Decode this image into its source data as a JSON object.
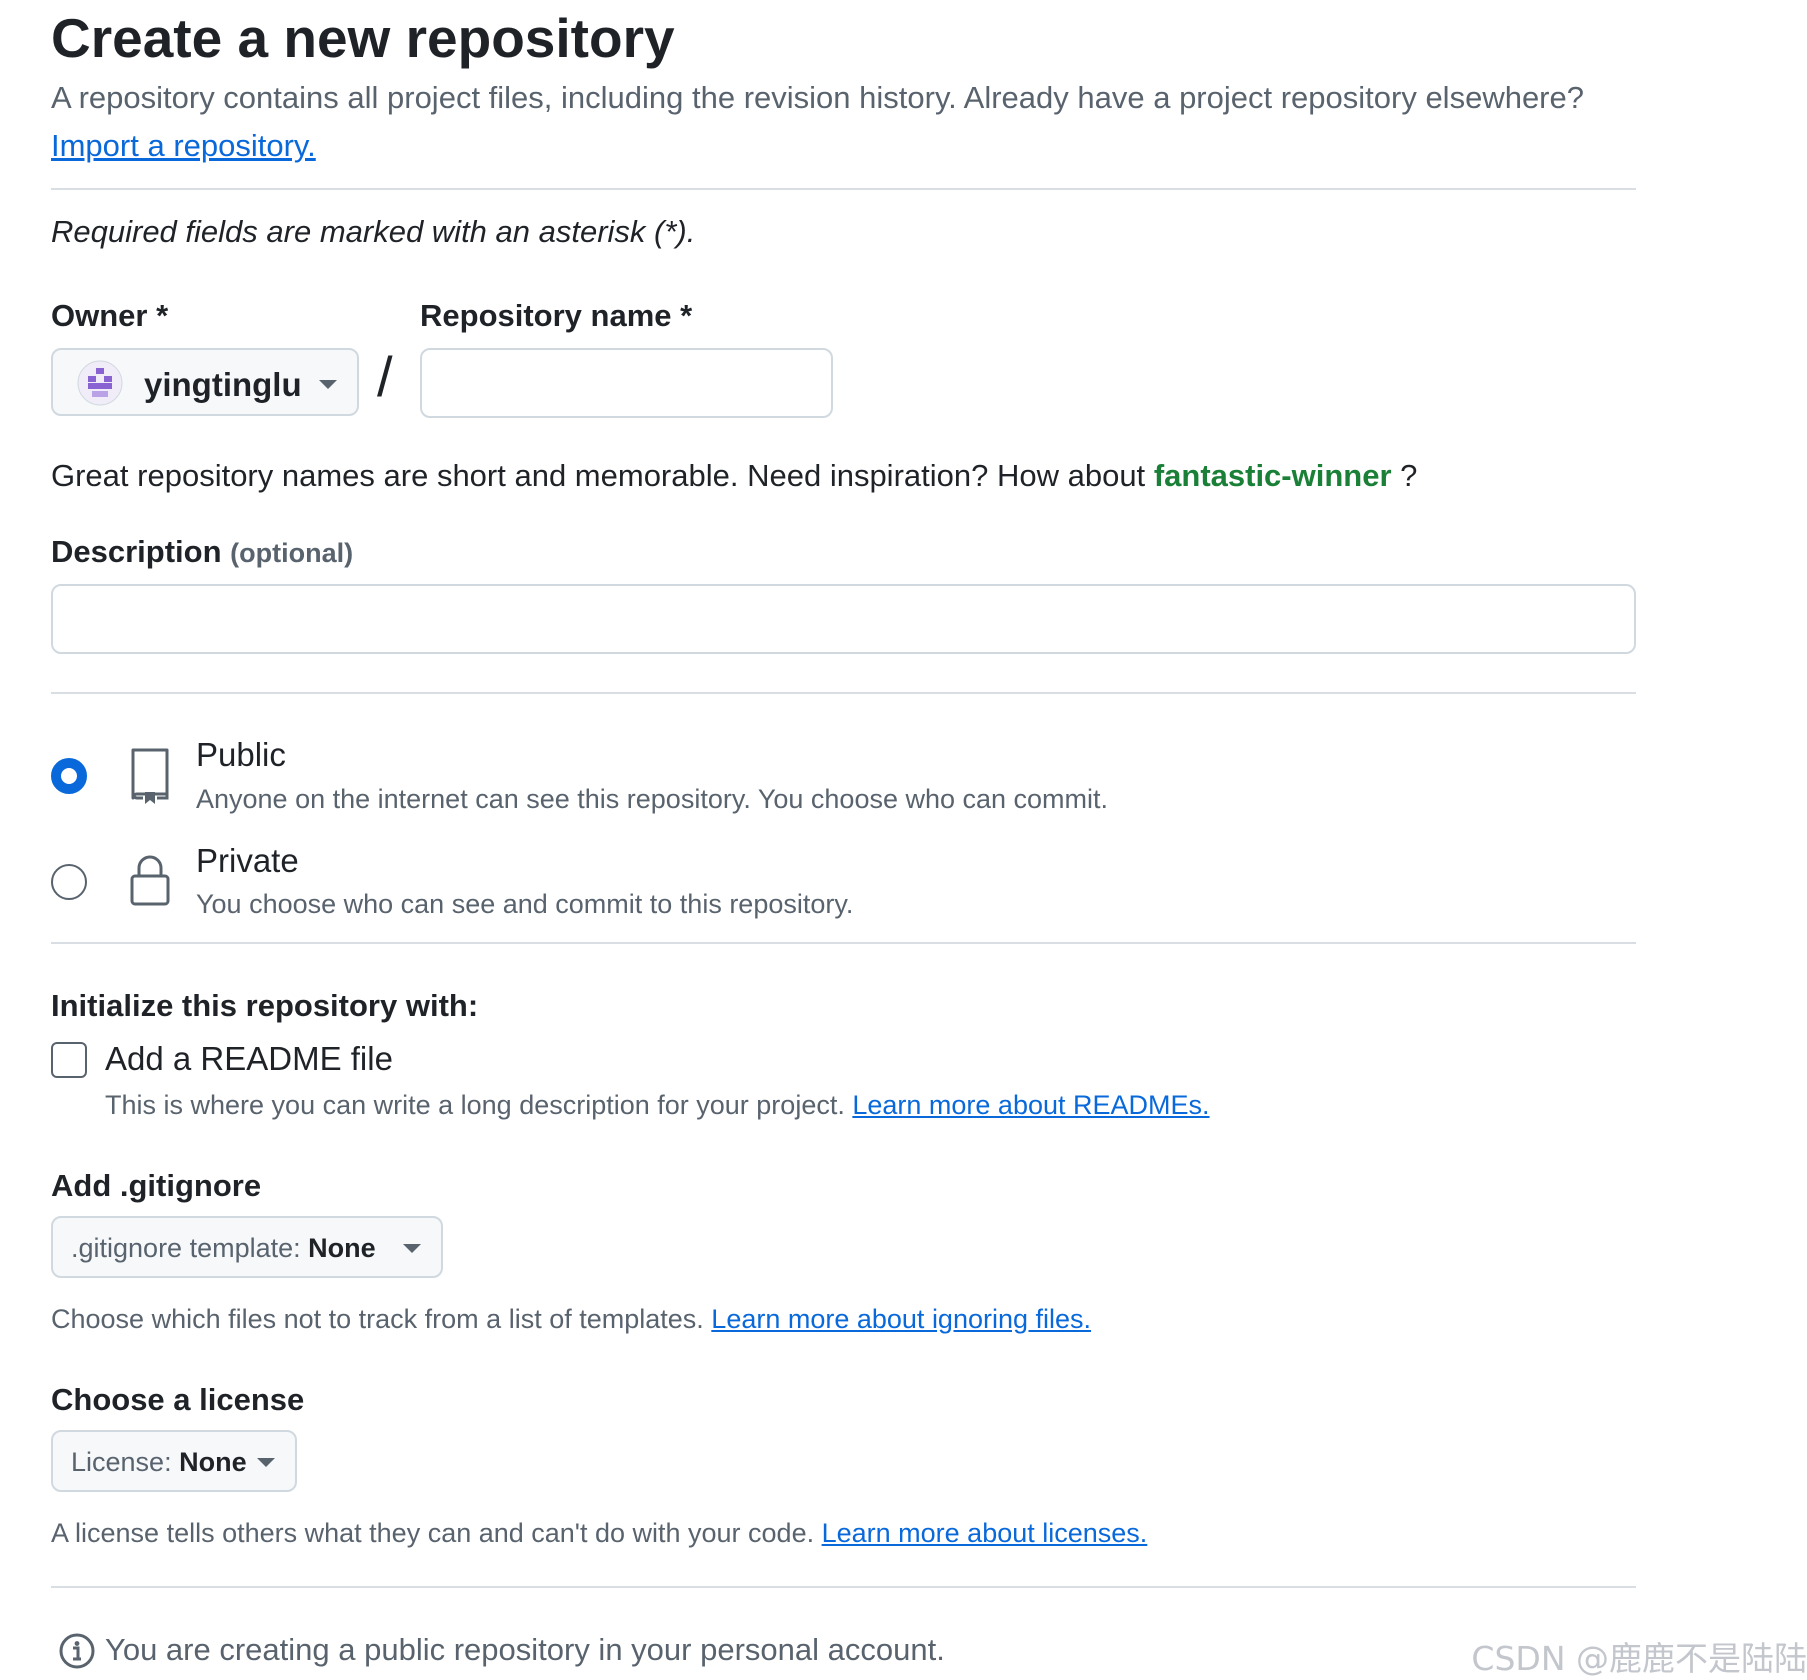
{
  "page": {
    "title": "Create a new repository",
    "lede": "A repository contains all project files, including the revision history. Already have a project repository elsewhere?",
    "import_link": "Import a repository.",
    "required_note": "Required fields are marked with an asterisk (*)."
  },
  "owner": {
    "label": "Owner *",
    "value": "yingtinglu",
    "avatar_icon": "identicon-avatar",
    "avatar_color": "#8a63d2"
  },
  "separator": "/",
  "repo_name": {
    "label": "Repository name *",
    "value": "",
    "placeholder": ""
  },
  "hint": {
    "text": "Great repository names are short and memorable. Need inspiration? How about",
    "suggestion": "fantastic-winner",
    "suffix": "?"
  },
  "description": {
    "label": "Description",
    "optional": "(optional)",
    "value": ""
  },
  "visibility": {
    "options": [
      {
        "title": "Public",
        "description": "Anyone on the internet can see this repository. You choose who can commit.",
        "icon": "repo-icon",
        "selected": true
      },
      {
        "title": "Private",
        "description": "You choose who can see and commit to this repository.",
        "icon": "lock-icon",
        "selected": false
      }
    ]
  },
  "initialize": {
    "title": "Initialize this repository with:",
    "readme_label": "Add a README file",
    "readme_checked": false,
    "readme_desc": "This is where you can write a long description for your project.",
    "readme_link": "Learn more about READMEs."
  },
  "gitignore": {
    "title": "Add .gitignore",
    "button_label": ".gitignore template:",
    "button_value": "None",
    "desc": "Choose which files not to track from a list of templates.",
    "link": "Learn more about ignoring files."
  },
  "license": {
    "title": "Choose a license",
    "button_label": "License:",
    "button_value": "None",
    "desc": "A license tells others what they can and can't do with your code.",
    "link": "Learn more about licenses."
  },
  "footer": {
    "info_text": "You are creating a public repository in your personal account.",
    "info_icon": "info-icon"
  },
  "watermark": "CSDN @鹿鹿不是陆陆",
  "colors": {
    "link": "#0969da",
    "accent_radio": "#0969da",
    "suggestion": "#1a7f37",
    "muted_text": "#59636e",
    "border": "#d1d9e0"
  }
}
